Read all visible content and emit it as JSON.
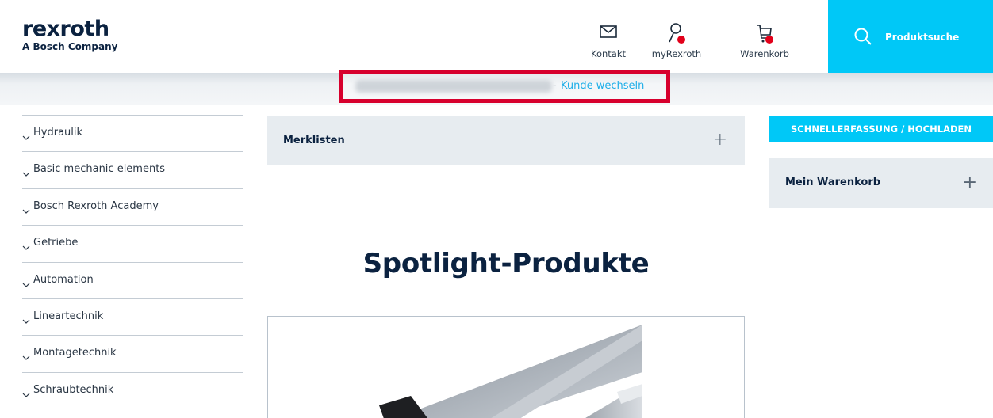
{
  "header": {
    "logo": {
      "word": "rexroth",
      "subtitle": "A Bosch Company"
    },
    "kontakt": {
      "label": "Kontakt",
      "icon": "mail-icon"
    },
    "myrexroth": {
      "label": "myRexroth",
      "icon": "user-icon"
    },
    "warenkorb": {
      "label": "Warenkorb",
      "icon": "cart-icon"
    },
    "search": {
      "label": "Produktsuche",
      "icon": "search-icon"
    },
    "accent_color": "#00c8f7",
    "notification_dot_color": "#e2001a"
  },
  "customer_bar": {
    "separator": "-",
    "change_link": "Kunde wechseln",
    "highlight_color": "#d7002d"
  },
  "sidebar": {
    "items": [
      {
        "label": "Hydraulik"
      },
      {
        "label": "Basic mechanic elements"
      },
      {
        "label": "Bosch Rexroth Academy"
      },
      {
        "label": "Getriebe"
      },
      {
        "label": "Automation"
      },
      {
        "label": "Lineartechnik"
      },
      {
        "label": "Montagetechnik"
      },
      {
        "label": "Schraubtechnik"
      }
    ]
  },
  "main": {
    "merklisten": {
      "label": "Merklisten",
      "toggle": "+"
    },
    "spotlight_title": "Spotlight-Produkte"
  },
  "right": {
    "quick_entry_label": "SCHNELLERFASSUNG / HOCHLADEN",
    "cart": {
      "label": "Mein Warenkorb",
      "toggle": "+"
    }
  }
}
